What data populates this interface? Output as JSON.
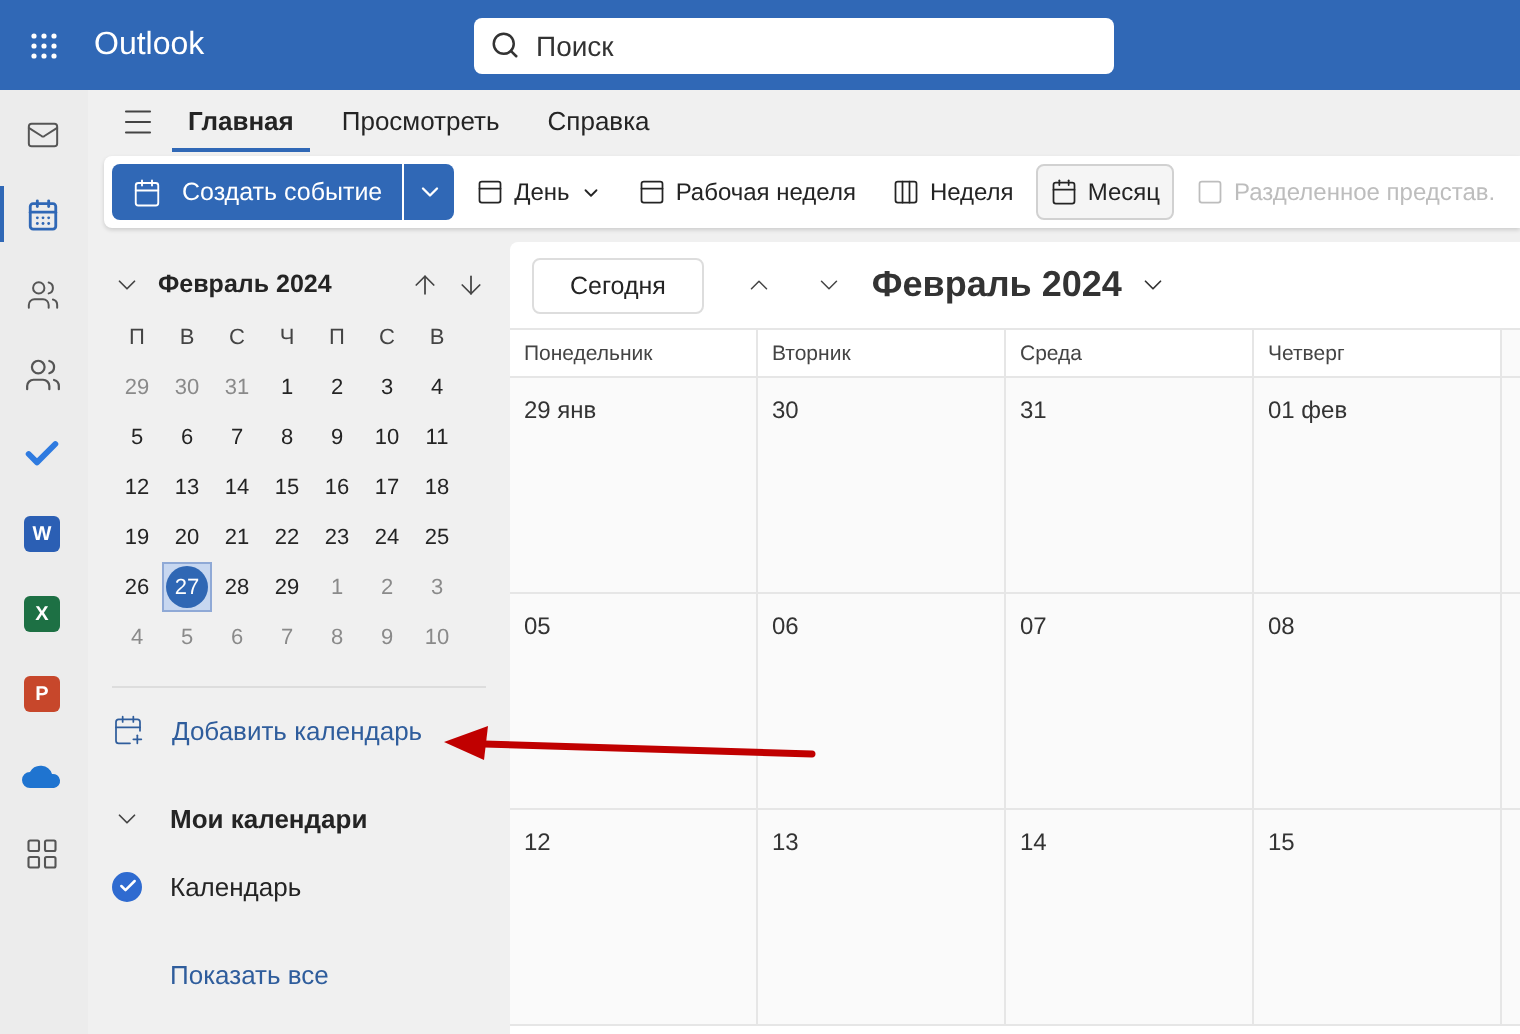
{
  "top_bar": {
    "app_name": "Outlook",
    "search": {
      "placeholder": "Поиск"
    }
  },
  "rail": [
    {
      "kind": "mail",
      "selected": false
    },
    {
      "kind": "calendar",
      "selected": true
    },
    {
      "kind": "people",
      "selected": false
    },
    {
      "kind": "groups",
      "selected": false
    },
    {
      "kind": "todo",
      "selected": false
    },
    {
      "kind": "app",
      "letter": "W",
      "color": "#2b5fb4",
      "selected": false
    },
    {
      "kind": "app",
      "letter": "X",
      "color": "#1d7044",
      "selected": false
    },
    {
      "kind": "app",
      "letter": "P",
      "color": "#c7472b",
      "selected": false
    },
    {
      "kind": "cloud",
      "selected": false
    },
    {
      "kind": "apps",
      "selected": false
    }
  ],
  "ribbon_tabs": [
    {
      "label": "Главная",
      "selected": true
    },
    {
      "label": "Просмотреть",
      "selected": false
    },
    {
      "label": "Справка",
      "selected": false
    }
  ],
  "toolbar": {
    "new_event": "Создать событие",
    "views": [
      {
        "label": "День",
        "kind": "day",
        "selected": false,
        "disabled": false,
        "dropdown": true
      },
      {
        "label": "Рабочая неделя",
        "kind": "workweek",
        "selected": false,
        "disabled": false,
        "dropdown": false
      },
      {
        "label": "Неделя",
        "kind": "week",
        "selected": false,
        "disabled": false,
        "dropdown": false
      },
      {
        "label": "Месяц",
        "kind": "month",
        "selected": true,
        "disabled": false,
        "dropdown": false
      },
      {
        "label": "Разделенное представ.",
        "kind": "split",
        "selected": false,
        "disabled": true,
        "dropdown": false
      }
    ]
  },
  "mini_calendar": {
    "title": "Февраль 2024",
    "weekdays": [
      "П",
      "В",
      "С",
      "Ч",
      "П",
      "С",
      "В"
    ],
    "weeks": [
      [
        {
          "day": "29",
          "muted": true,
          "selected": false
        },
        {
          "day": "30",
          "muted": true,
          "selected": false
        },
        {
          "day": "31",
          "muted": true,
          "selected": false
        },
        {
          "day": "1",
          "muted": false,
          "selected": false
        },
        {
          "day": "2",
          "muted": false,
          "selected": false
        },
        {
          "day": "3",
          "muted": false,
          "selected": false
        },
        {
          "day": "4",
          "muted": false,
          "selected": false
        }
      ],
      [
        {
          "day": "5",
          "muted": false,
          "selected": false
        },
        {
          "day": "6",
          "muted": false,
          "selected": false
        },
        {
          "day": "7",
          "muted": false,
          "selected": false
        },
        {
          "day": "8",
          "muted": false,
          "selected": false
        },
        {
          "day": "9",
          "muted": false,
          "selected": false
        },
        {
          "day": "10",
          "muted": false,
          "selected": false
        },
        {
          "day": "11",
          "muted": false,
          "selected": false
        }
      ],
      [
        {
          "day": "12",
          "muted": false,
          "selected": false
        },
        {
          "day": "13",
          "muted": false,
          "selected": false
        },
        {
          "day": "14",
          "muted": false,
          "selected": false
        },
        {
          "day": "15",
          "muted": false,
          "selected": false
        },
        {
          "day": "16",
          "muted": false,
          "selected": false
        },
        {
          "day": "17",
          "muted": false,
          "selected": false
        },
        {
          "day": "18",
          "muted": false,
          "selected": false
        }
      ],
      [
        {
          "day": "19",
          "muted": false,
          "selected": false
        },
        {
          "day": "20",
          "muted": false,
          "selected": false
        },
        {
          "day": "21",
          "muted": false,
          "selected": false
        },
        {
          "day": "22",
          "muted": false,
          "selected": false
        },
        {
          "day": "23",
          "muted": false,
          "selected": false
        },
        {
          "day": "24",
          "muted": false,
          "selected": false
        },
        {
          "day": "25",
          "muted": false,
          "selected": false
        }
      ],
      [
        {
          "day": "26",
          "muted": false,
          "selected": false
        },
        {
          "day": "27",
          "muted": false,
          "selected": true
        },
        {
          "day": "28",
          "muted": false,
          "selected": false
        },
        {
          "day": "29",
          "muted": false,
          "selected": false
        },
        {
          "day": "1",
          "muted": true,
          "selected": false
        },
        {
          "day": "2",
          "muted": true,
          "selected": false
        },
        {
          "day": "3",
          "muted": true,
          "selected": false
        }
      ],
      [
        {
          "day": "4",
          "muted": true,
          "selected": false
        },
        {
          "day": "5",
          "muted": true,
          "selected": false
        },
        {
          "day": "6",
          "muted": true,
          "selected": false
        },
        {
          "day": "7",
          "muted": true,
          "selected": false
        },
        {
          "day": "8",
          "muted": true,
          "selected": false
        },
        {
          "day": "9",
          "muted": true,
          "selected": false
        },
        {
          "day": "10",
          "muted": true,
          "selected": false
        }
      ]
    ]
  },
  "add_calendar": "Добавить календарь",
  "my_calendars": {
    "title": "Мои календари",
    "expanded": true,
    "items": [
      {
        "label": "Календарь",
        "checked": true
      }
    ]
  },
  "show_all": "Показать все",
  "month_view": {
    "today_button": "Сегодня",
    "title": "Февраль 2024",
    "columns": [
      "Понедельник",
      "Вторник",
      "Среда",
      "Четверг"
    ],
    "weeks": [
      [
        "29 янв",
        "30",
        "31",
        "01 фев"
      ],
      [
        "05",
        "06",
        "07",
        "08"
      ],
      [
        "12",
        "13",
        "14",
        "15"
      ]
    ]
  }
}
